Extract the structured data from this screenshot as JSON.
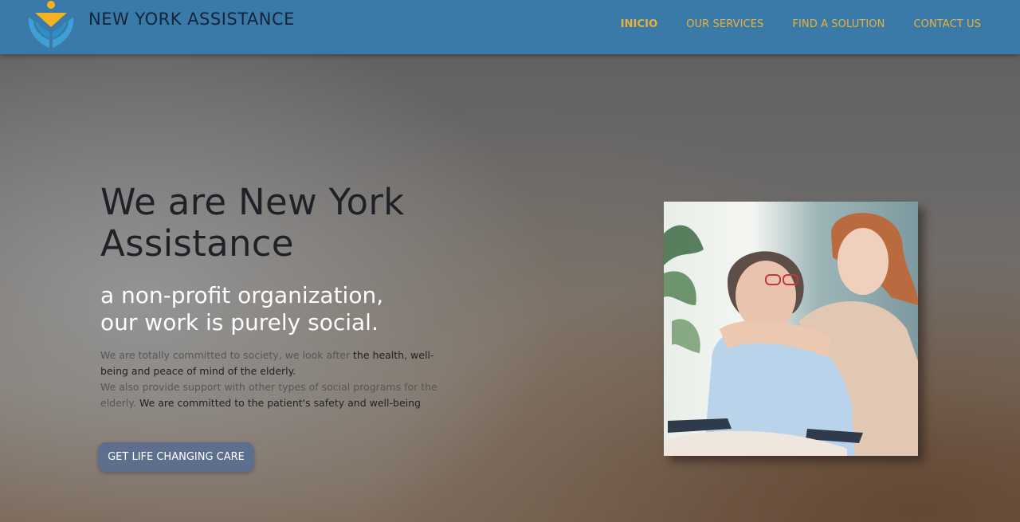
{
  "header": {
    "brand": "NEW YORK ASSISTANCE",
    "logo_icon": "hands-heart-logo-icon",
    "nav": [
      {
        "label": "INICIO",
        "active": true
      },
      {
        "label": "OUR SERVICES",
        "active": false
      },
      {
        "label": "FIND A SOLUTION",
        "active": false
      },
      {
        "label": "CONTACT US",
        "active": false
      }
    ]
  },
  "hero": {
    "title_line1": "We are New York",
    "title_line2": "Assistance",
    "subtitle_line1": "a non-profit organization,",
    "subtitle_line2": "our work is purely social.",
    "desc_part1": "We are totally committed to society, we look after ",
    "desc_bold1": "the health, well-being and peace of mind of the elderly.",
    "desc_part2": "We also provide support with other types of social programs for the elderly. ",
    "desc_bold2": "We are committed to the patient's safety and well-being",
    "cta_label": "GET LIFE CHANGING CARE"
  },
  "colors": {
    "header_bg": "#3a7aa8",
    "nav_text": "#e8b23a",
    "cta_bg": "#5d6f8c",
    "logo_blue": "#3fa0d8",
    "logo_yellow": "#f2b41e"
  }
}
